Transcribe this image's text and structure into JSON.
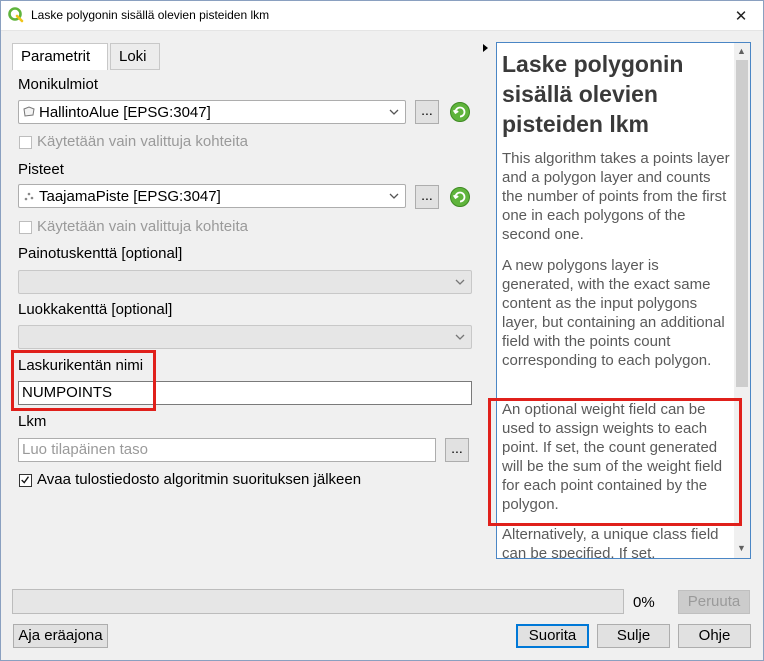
{
  "window": {
    "title": "Laske polygonin sisällä olevien pisteiden lkm",
    "close_glyph": "✕"
  },
  "tabs": [
    {
      "label": "Parametrit",
      "active": true
    },
    {
      "label": "Loki",
      "active": false
    }
  ],
  "form": {
    "polygons": {
      "label": "Monikulmiot",
      "value": "HallintoAlue [EPSG:3047]",
      "selected_only_label": "Käytetään vain valittuja kohteita",
      "browse_label": "..."
    },
    "points": {
      "label": "Pisteet",
      "value": "TaajamaPiste [EPSG:3047]",
      "selected_only_label": "Käytetään vain valittuja kohteita",
      "browse_label": "..."
    },
    "weight_field": {
      "label": "Painotuskenttä [optional]",
      "value": ""
    },
    "class_field": {
      "label": "Luokkakenttä [optional]",
      "value": ""
    },
    "count_field": {
      "label": "Laskurikentän nimi",
      "value": "NUMPOINTS"
    },
    "output": {
      "label": "Lkm",
      "placeholder": "Luo tilapäinen taso",
      "browse_label": "..."
    },
    "open_output": {
      "label": "Avaa tulostiedosto algoritmin suorituksen jälkeen",
      "checked": true
    }
  },
  "help": {
    "title": "Laske polygonin sisällä olevien pisteiden lkm",
    "paragraphs": [
      "This algorithm takes a points layer and a polygon layer and counts the number of points from the first one in each polygons of the second one.",
      "A new polygons layer is generated, with the exact same content as the input polygons layer, but containing an additional field with the points count corresponding to each polygon.",
      "An optional weight field can be used to assign weights to each point. If set, the count generated will be the sum of the weight field for each point contained by the polygon.",
      "Alternatively, a unique class field can be specified. If set,"
    ]
  },
  "footer": {
    "progress_text": "0%",
    "progress_value": 0,
    "cancel_label": "Peruuta",
    "batch_label": "Aja eräajona",
    "run_label": "Suorita",
    "close_label": "Sulje",
    "help_label": "Ohje"
  },
  "colors": {
    "highlight": "#e0201b",
    "accent": "#0078d7",
    "qgis_green": "#5fb43c"
  }
}
